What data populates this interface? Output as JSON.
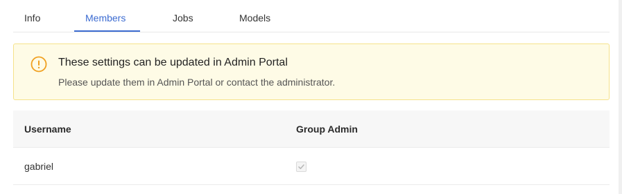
{
  "tabs": [
    {
      "label": "Info",
      "active": false
    },
    {
      "label": "Members",
      "active": true
    },
    {
      "label": "Jobs",
      "active": false
    },
    {
      "label": "Models",
      "active": false
    }
  ],
  "alert": {
    "icon": "warning-circle-icon",
    "title": "These settings can be updated in Admin Portal",
    "description": "Please update them in Admin Portal or contact the administrator."
  },
  "table": {
    "columns": [
      "Username",
      "Group Admin"
    ],
    "rows": [
      {
        "username": "gabriel",
        "group_admin": true,
        "checkbox_disabled": true
      }
    ]
  },
  "colors": {
    "accent": "#3b6bd1",
    "alert_bg": "#fefbe6",
    "alert_border": "#f5e28a",
    "alert_icon": "#f0a020"
  }
}
